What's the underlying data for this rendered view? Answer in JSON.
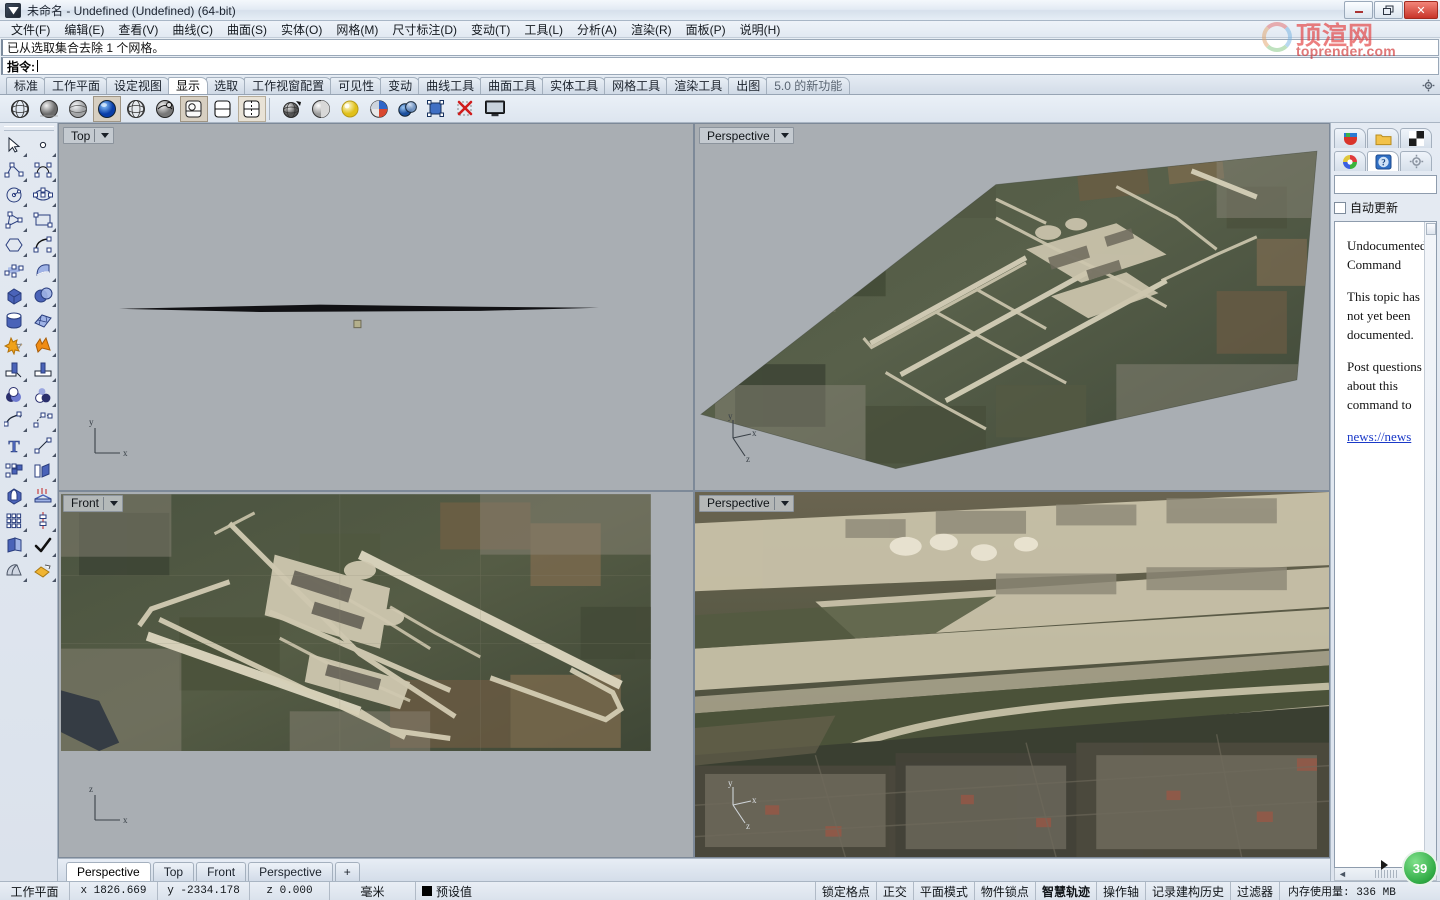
{
  "window": {
    "title": "未命名 - Undefined (Undefined) (64-bit)",
    "buttons": {
      "minimize": "─",
      "maximize": "❐",
      "close": "✕"
    },
    "watermark_cn": "顶渲网",
    "watermark_en": "toprender.com"
  },
  "menu": {
    "items": [
      {
        "label": "文件(F)",
        "name": "menu-file"
      },
      {
        "label": "编辑(E)",
        "name": "menu-edit"
      },
      {
        "label": "查看(V)",
        "name": "menu-view"
      },
      {
        "label": "曲线(C)",
        "name": "menu-curve"
      },
      {
        "label": "曲面(S)",
        "name": "menu-surface"
      },
      {
        "label": "实体(O)",
        "name": "menu-solid"
      },
      {
        "label": "网格(M)",
        "name": "menu-mesh"
      },
      {
        "label": "尺寸标注(D)",
        "name": "menu-dimension"
      },
      {
        "label": "变动(T)",
        "name": "menu-transform"
      },
      {
        "label": "工具(L)",
        "name": "menu-tools"
      },
      {
        "label": "分析(A)",
        "name": "menu-analyze"
      },
      {
        "label": "渲染(R)",
        "name": "menu-render"
      },
      {
        "label": "面板(P)",
        "name": "menu-panels"
      },
      {
        "label": "说明(H)",
        "name": "menu-help"
      }
    ]
  },
  "command": {
    "history": "已从选取集合去除 1 个网格。",
    "prompt_label": "指令:",
    "input_value": ""
  },
  "toolbar_tabs": {
    "active_index": 3,
    "items": [
      {
        "label": "标准"
      },
      {
        "label": "工作平面"
      },
      {
        "label": "设定视图"
      },
      {
        "label": "显示"
      },
      {
        "label": "选取"
      },
      {
        "label": "工作视窗配置"
      },
      {
        "label": "可见性"
      },
      {
        "label": "变动"
      },
      {
        "label": "曲线工具"
      },
      {
        "label": "曲面工具"
      },
      {
        "label": "实体工具"
      },
      {
        "label": "网格工具"
      },
      {
        "label": "渲染工具"
      },
      {
        "label": "出图"
      },
      {
        "label": "5.0 的新功能"
      }
    ]
  },
  "display_toolbar": {
    "buttons": [
      {
        "name": "wireframe-display-icon",
        "state": "normal"
      },
      {
        "name": "shaded-display-icon",
        "state": "normal"
      },
      {
        "name": "ghosted-display-icon",
        "state": "normal"
      },
      {
        "name": "rendered-display-icon",
        "state": "selected"
      },
      {
        "name": "xray-display-icon",
        "state": "normal"
      },
      {
        "name": "technical-display-icon",
        "state": "normal"
      },
      {
        "name": "artistic-display-icon",
        "state": "selected"
      },
      {
        "name": "pen-display-icon",
        "state": "normal"
      },
      {
        "name": "arctic-display-icon",
        "state": "selected2"
      },
      {
        "name": "shade-command-icon",
        "state": "normal"
      },
      {
        "name": "flat-shade-icon",
        "state": "normal"
      },
      {
        "name": "render-preview-icon",
        "state": "normal"
      },
      {
        "name": "render-color-icon",
        "state": "normal"
      },
      {
        "name": "isocurve-density-icon",
        "state": "normal"
      },
      {
        "name": "show-edges-icon",
        "state": "normal"
      },
      {
        "name": "hide-edges-icon",
        "state": "normal"
      },
      {
        "name": "fullscreen-display-icon",
        "state": "normal"
      }
    ]
  },
  "left_toolbar": {
    "buttons": [
      {
        "name": "select-arrow-icon"
      },
      {
        "name": "point-icon"
      },
      {
        "name": "polyline-icon"
      },
      {
        "name": "control-point-curve-icon"
      },
      {
        "name": "circle-icon"
      },
      {
        "name": "ellipse-icon"
      },
      {
        "name": "polygon-triangle-icon"
      },
      {
        "name": "rectangle-icon"
      },
      {
        "name": "polygon-icon"
      },
      {
        "name": "arc-icon"
      },
      {
        "name": "surface-from-points-icon"
      },
      {
        "name": "extrude-surface-icon"
      },
      {
        "name": "box-icon"
      },
      {
        "name": "sphere-boolean-icon"
      },
      {
        "name": "cylinder-icon"
      },
      {
        "name": "mesh-plane-icon"
      },
      {
        "name": "explode-star-icon"
      },
      {
        "name": "fillet-orange-icon"
      },
      {
        "name": "trim-icon"
      },
      {
        "name": "split-icon"
      },
      {
        "name": "boolean-union-icon"
      },
      {
        "name": "boolean-difference-icon"
      },
      {
        "name": "rebuild-curve-icon"
      },
      {
        "name": "curve-tools-icon"
      },
      {
        "name": "text-object-icon"
      },
      {
        "name": "scale-icon"
      },
      {
        "name": "array-icon"
      },
      {
        "name": "extrude-planar-icon"
      },
      {
        "name": "cap-icon"
      },
      {
        "name": "contour-icon"
      },
      {
        "name": "grid-array-icon"
      },
      {
        "name": "mirror-axis-icon"
      },
      {
        "name": "offset-surface-icon"
      },
      {
        "name": "check-object-icon"
      },
      {
        "name": "shade-object-icon"
      },
      {
        "name": "paint-material-icon"
      }
    ]
  },
  "viewports": [
    {
      "name": "viewport-top",
      "label": "Top",
      "bg": "#a9aeb3",
      "axes": [
        "y",
        "x"
      ],
      "content": "gray-with-line"
    },
    {
      "name": "viewport-perspective-1",
      "label": "Perspective",
      "bg": "#a9aeb3",
      "axes": [
        "y",
        "x",
        "z"
      ],
      "content": "terrain-mesh-perspective"
    },
    {
      "name": "viewport-front",
      "label": "Front",
      "bg": "#a9aeb3",
      "axes": [
        "z",
        "x"
      ],
      "content": "aerial-plan"
    },
    {
      "name": "viewport-perspective-2",
      "label": "Perspective",
      "bg": "#a9aeb3",
      "axes": [
        "y",
        "x",
        "z"
      ],
      "content": "aerial-oblique"
    }
  ],
  "viewport_tabs": {
    "active_index": 0,
    "items": [
      {
        "label": "Perspective"
      },
      {
        "label": "Top"
      },
      {
        "label": "Front"
      },
      {
        "label": "Perspective"
      },
      {
        "label": "+"
      }
    ]
  },
  "right_panel": {
    "tabs_row1": [
      {
        "name": "layers-tab-icon",
        "active": false
      },
      {
        "name": "properties-folder-tab-icon",
        "active": false
      },
      {
        "name": "display-tab-icon",
        "active": false
      }
    ],
    "tabs_row2": [
      {
        "name": "material-color-tab-icon",
        "active": false
      },
      {
        "name": "help-tab-icon",
        "active": true
      },
      {
        "name": "options-gear-tab-icon",
        "active": false
      }
    ],
    "search_value": "",
    "auto_update_label": "自动更新",
    "auto_update_checked": false,
    "help": {
      "title": "Undocumented Command",
      "paragraph1": "This topic has not yet been documented.",
      "paragraph2": "Post questions about this command to",
      "link": "news://news"
    }
  },
  "status_bar": {
    "cplane_label": "工作平面",
    "x": "x 1826.669",
    "y": "y -2334.178",
    "z": "z 0.000",
    "units": "毫米",
    "layer": "预设值",
    "layer_color": "#000000",
    "toggles": [
      {
        "label": "锁定格点",
        "bold": false
      },
      {
        "label": "正交",
        "bold": false
      },
      {
        "label": "平面模式",
        "bold": false
      },
      {
        "label": "物件锁点",
        "bold": false
      },
      {
        "label": "智慧轨迹",
        "bold": true
      },
      {
        "label": "操作轴",
        "bold": false
      },
      {
        "label": "记录建构历史",
        "bold": false
      },
      {
        "label": "过滤器",
        "bold": false
      }
    ],
    "memory": "内存使用量: 336 MB"
  },
  "progress_badge": {
    "value": "39"
  }
}
